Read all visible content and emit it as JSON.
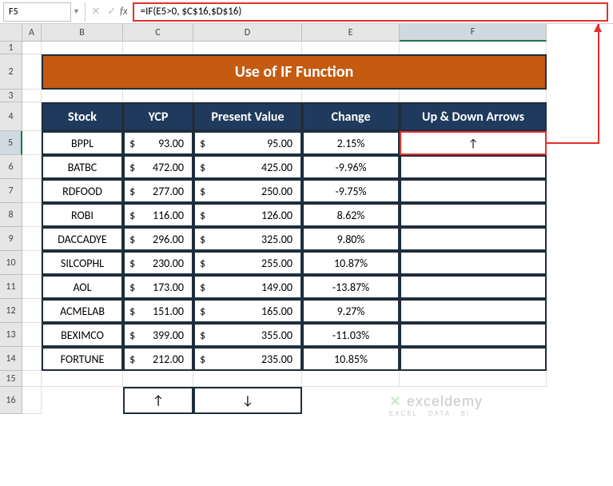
{
  "nameBox": "F5",
  "formula": "=IF(E5>0, $C$16,$D$16)",
  "title": "Use of IF Function",
  "columns": [
    "A",
    "B",
    "C",
    "D",
    "E",
    "F"
  ],
  "rows": [
    "1",
    "2",
    "3",
    "4",
    "5",
    "6",
    "7",
    "8",
    "9",
    "10",
    "11",
    "12",
    "13",
    "14",
    "15",
    "16"
  ],
  "headers": {
    "stock": "Stock",
    "ycp": "YCP",
    "present": "Present Value",
    "change": "Change",
    "arrows": "Up & Down Arrows"
  },
  "data": [
    {
      "stock": "BPPL",
      "ycp": "93.00",
      "present": "95.00",
      "change": "2.15%",
      "arrow": "↑"
    },
    {
      "stock": "BATBC",
      "ycp": "472.00",
      "present": "425.00",
      "change": "-9.96%",
      "arrow": ""
    },
    {
      "stock": "RDFOOD",
      "ycp": "277.00",
      "present": "250.00",
      "change": "-9.75%",
      "arrow": ""
    },
    {
      "stock": "ROBI",
      "ycp": "116.00",
      "present": "126.00",
      "change": "8.62%",
      "arrow": ""
    },
    {
      "stock": "DACCADYE",
      "ycp": "296.00",
      "present": "325.00",
      "change": "9.80%",
      "arrow": ""
    },
    {
      "stock": "SILCOPHL",
      "ycp": "230.00",
      "present": "255.00",
      "change": "10.87%",
      "arrow": ""
    },
    {
      "stock": "AOL",
      "ycp": "173.00",
      "present": "149.00",
      "change": "-13.87%",
      "arrow": ""
    },
    {
      "stock": "ACMELAB",
      "ycp": "151.00",
      "present": "165.00",
      "change": "9.27%",
      "arrow": ""
    },
    {
      "stock": "BEXIMCO",
      "ycp": "399.00",
      "present": "355.00",
      "change": "-11.03%",
      "arrow": ""
    },
    {
      "stock": "FORTUNE",
      "ycp": "212.00",
      "present": "235.00",
      "change": "10.85%",
      "arrow": ""
    }
  ],
  "refCells": {
    "up": "↑",
    "down": "↓"
  },
  "currency": "$",
  "watermark": {
    "name": "exceldemy",
    "tag": "EXCEL · DATA · BI"
  },
  "chart_data": {
    "type": "table",
    "title": "Use of IF Function",
    "columns": [
      "Stock",
      "YCP",
      "Present Value",
      "Change",
      "Up & Down Arrows"
    ],
    "rows": [
      [
        "BPPL",
        93.0,
        95.0,
        0.0215,
        "↑"
      ],
      [
        "BATBC",
        472.0,
        425.0,
        -0.0996,
        ""
      ],
      [
        "RDFOOD",
        277.0,
        250.0,
        -0.0975,
        ""
      ],
      [
        "ROBI",
        116.0,
        126.0,
        0.0862,
        ""
      ],
      [
        "DACCADYE",
        296.0,
        325.0,
        0.098,
        ""
      ],
      [
        "SILCOPHL",
        230.0,
        255.0,
        0.1087,
        ""
      ],
      [
        "AOL",
        173.0,
        149.0,
        -0.1387,
        ""
      ],
      [
        "ACMELAB",
        151.0,
        165.0,
        0.0927,
        ""
      ],
      [
        "BEXIMCO",
        399.0,
        355.0,
        -0.1103,
        ""
      ],
      [
        "FORTUNE",
        212.0,
        235.0,
        0.1085,
        ""
      ]
    ]
  }
}
